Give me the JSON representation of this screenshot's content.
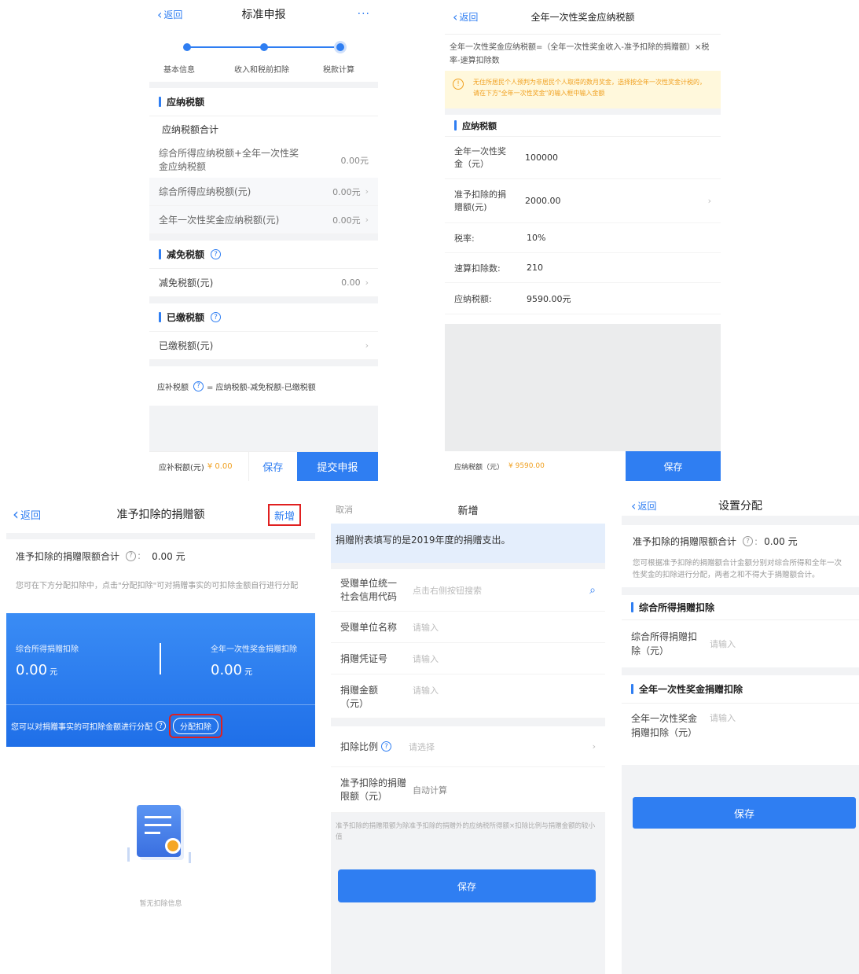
{
  "s1": {
    "back": "返回",
    "title": "标准申报",
    "more": "···",
    "steps": [
      "基本信息",
      "收入和税前扣除",
      "税款计算"
    ],
    "sec1": "应纳税额",
    "total_title": "应纳税额合计",
    "total_desc": "综合所得应纳税额+全年一次性奖金应纳税额",
    "total_val": "0.00元",
    "row_comp": "综合所得应纳税额(元)",
    "row_comp_val": "0.00元",
    "row_bonus": "全年一次性奖金应纳税额(元)",
    "row_bonus_val": "0.00元",
    "sec2": "减免税额",
    "row_reduce": "减免税额(元)",
    "row_reduce_val": "0.00",
    "sec3": "已缴税额",
    "row_paid": "已缴税额(元)",
    "formula_label": "应补税额",
    "formula": "= 应纳税额-减免税额-已缴税额",
    "foot_label": "应补税额(元)",
    "foot_val": "¥ 0.00",
    "save": "保存",
    "submit": "提交申报"
  },
  "s2": {
    "back": "返回",
    "title": "全年一次性奖金应纳税额",
    "formula": "全年一次性奖金应纳税额=（全年一次性奖金收入-准予扣除的捐赠额）×税率-速算扣除数",
    "warn": "无住所居民个人预判为非居民个人取得的数月奖金，选择按全年一次性奖金计税的，请在下方\"全年一次性奖金\"的输入框中输入金额",
    "warn_icon": "!",
    "sec": "应纳税额",
    "rows": [
      {
        "k": "全年一次性奖金（元）",
        "v": "100000"
      },
      {
        "k": "准予扣除的捐赠额(元)",
        "v": "2000.00"
      },
      {
        "k": "税率:",
        "v": "10%"
      },
      {
        "k": "速算扣除数:",
        "v": "210"
      },
      {
        "k": "应纳税额:",
        "v": "9590.00元"
      }
    ],
    "foot_label": "应纳税额（元）",
    "foot_val": "¥ 9590.00",
    "save": "保存"
  },
  "s3": {
    "back": "返回",
    "title": "准予扣除的捐赠额",
    "add": "新增",
    "limit_label": "准予扣除的捐赠限额合计",
    "limit_val": "0.00 元",
    "tip": "您可在下方分配扣除中，点击\"分配扣除\"可对捐赠事实的可扣除金额自行进行分配",
    "card_left_label": "综合所得捐赠扣除",
    "card_left_val": "0.00",
    "card_right_label": "全年一次性奖金捐赠扣除",
    "card_right_val": "0.00",
    "unit": "元",
    "allot_text": "您可以对捐赠事实的可扣除金额进行分配",
    "allot_btn": "分配扣除",
    "empty": "暂无扣除信息",
    "colors": {
      "primary": "#2f7ef2",
      "highlight": "#e02020"
    }
  },
  "s4": {
    "cancel": "取消",
    "title": "新增",
    "banner": "捐赠附表填写的是2019年度的捐赠支出。",
    "f_code_label": "受赠单位统一社会信用代码",
    "f_code_ph": "点击右侧按钮搜索",
    "f_name_label": "受赠单位名称",
    "f_name_ph": "请输入",
    "f_voucher_label": "捐赠凭证号",
    "f_voucher_ph": "请输入",
    "f_amount_label": "捐赠金额（元）",
    "f_amount_ph": "请输入",
    "f_ratio_label": "扣除比例",
    "f_ratio_ph": "请选择",
    "f_limit_label": "准予扣除的捐赠限额（元）",
    "f_limit_val": "自动计算",
    "note": "准予扣除的捐赠限额为除准予扣除的捐赠外的应纳税所得额×扣除比例与捐赠金额的较小值",
    "save": "保存"
  },
  "s5": {
    "back": "返回",
    "title": "设置分配",
    "limit_label": "准予扣除的捐赠限额合计",
    "limit_val": "0.00 元",
    "desc": "您可根据准予扣除的捐赠额合计金额分别对综合所得和全年一次性奖金的扣除进行分配，两者之和不得大于捐赠额合计。",
    "sec1": "综合所得捐赠扣除",
    "f1_label": "综合所得捐赠扣除（元）",
    "f1_ph": "请输入",
    "sec2": "全年一次性奖金捐赠扣除",
    "f2_label": "全年一次性奖金捐赠扣除（元）",
    "f2_ph": "请输入",
    "save": "保存"
  }
}
